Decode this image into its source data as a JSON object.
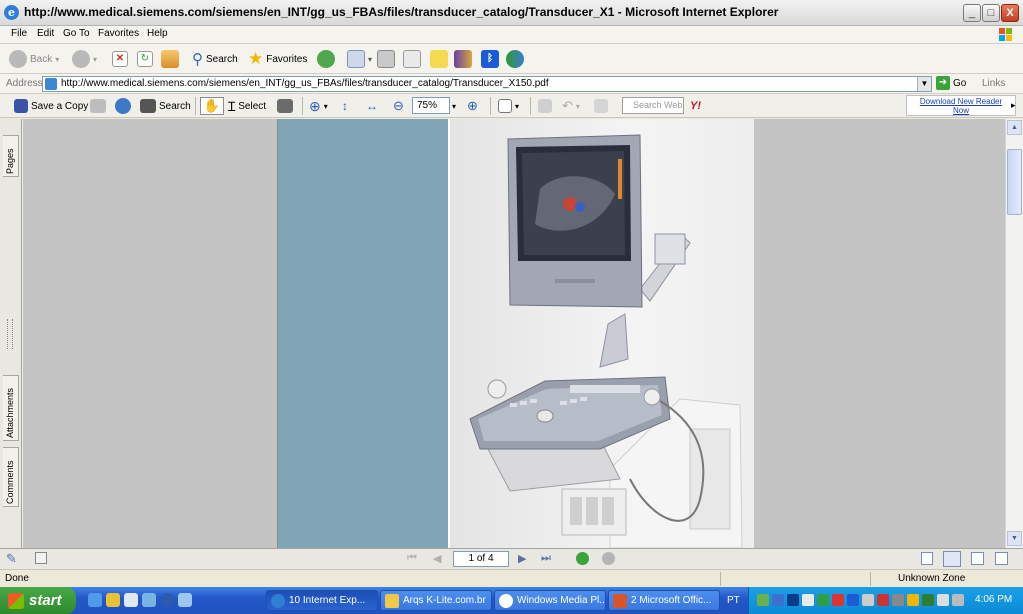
{
  "window": {
    "title": "http://www.medical.siemens.com/siemens/en_INT/gg_us_FBAs/files/transducer_catalog/Transducer_X1 - Microsoft Internet Explorer",
    "minimize": "_",
    "maximize": "□",
    "close": "X"
  },
  "menu": [
    "File",
    "Edit",
    "Go To",
    "Favorites",
    "Help"
  ],
  "toolbar": {
    "back": "Back",
    "search": "Search",
    "favorites": "Favorites"
  },
  "address": {
    "label": "Address",
    "url": "http://www.medical.siemens.com/siemens/en_INT/gg_us_FBAs/files/transducer_catalog/Transducer_X150.pdf",
    "go": "Go",
    "links": "Links"
  },
  "acrobat": {
    "save_copy": "Save a Copy",
    "search": "Search",
    "select": "Select",
    "zoom": "75%",
    "search_web_placeholder": "Search Web",
    "download_reader_line1": "Download New Reader",
    "download_reader_line2": "Now"
  },
  "side_tabs": [
    "Pages",
    "Attachments",
    "Comments"
  ],
  "pagination": {
    "page_display": "1 of 4"
  },
  "ie_status": {
    "text": "Done",
    "zone": "Unknown Zone"
  },
  "taskbar": {
    "start": "start",
    "tasks": [
      {
        "label": "10 Internet Exp...",
        "active": true
      },
      {
        "label": "Arqs K-Lite.com.br",
        "active": false
      },
      {
        "label": "Windows Media Pl...",
        "active": false
      },
      {
        "label": "2 Microsoft Offic...",
        "active": false
      }
    ],
    "language": "PT",
    "clock": "4:06 PM"
  },
  "colors": {
    "blue_panel": "#7fa5b6",
    "taskbar": "#2457c8",
    "start": "#3a9a3a"
  }
}
